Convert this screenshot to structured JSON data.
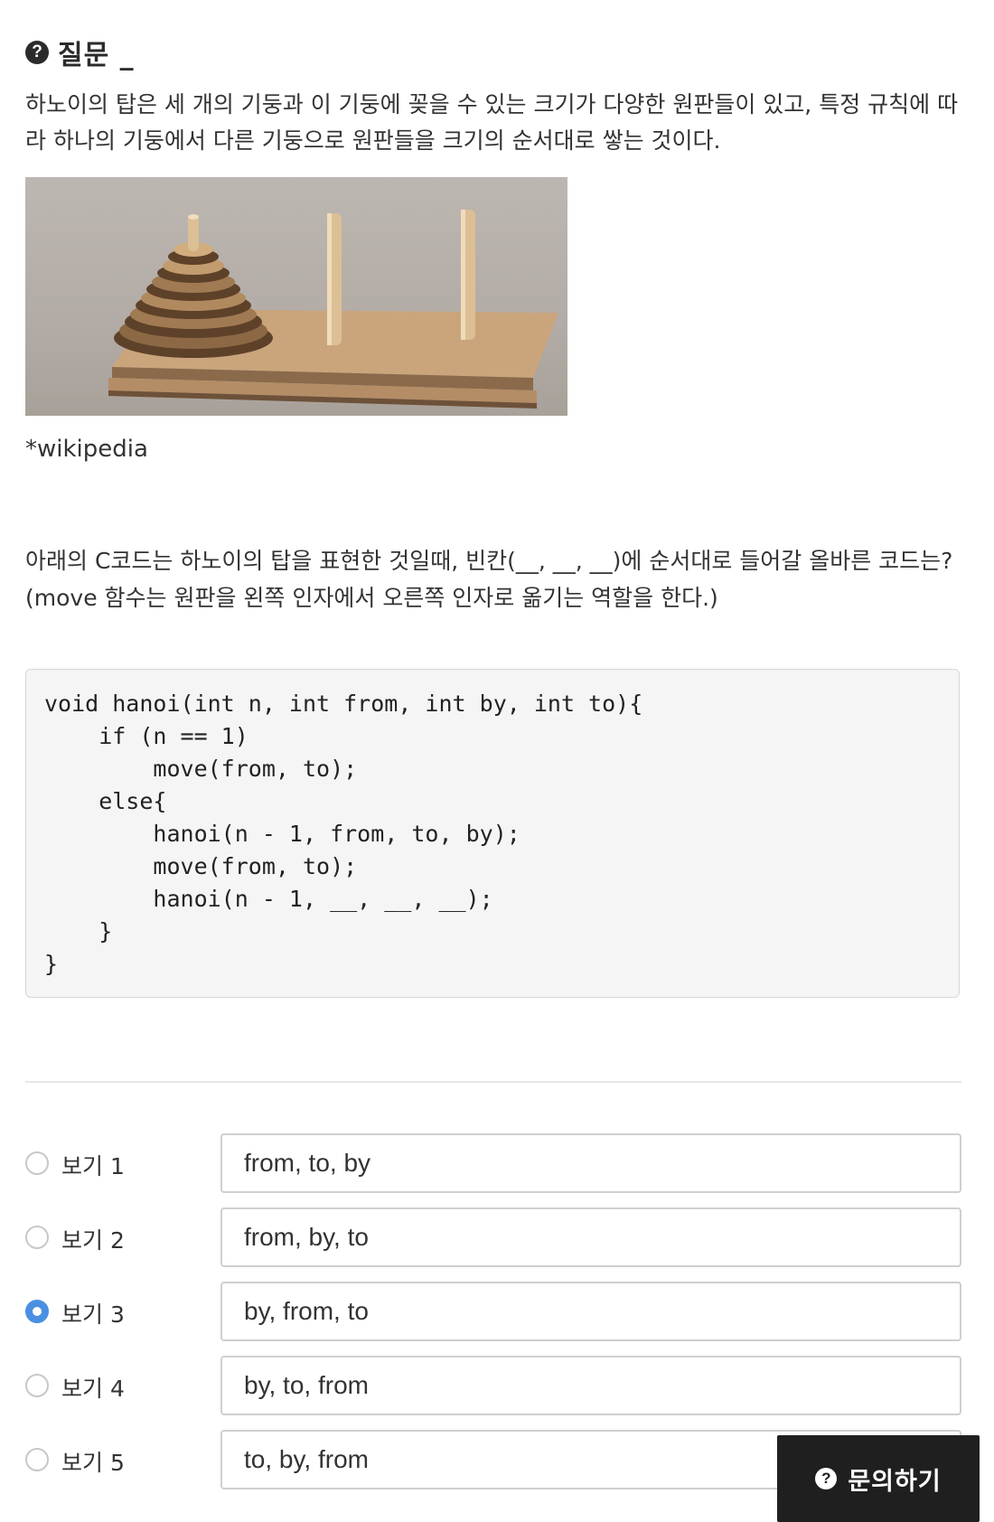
{
  "question": {
    "header_title": "질문 _",
    "description": "하노이의 탑은 세 개의 기둥과 이 기둥에 꽂을 수 있는 크기가 다양한 원판들이 있고, 특정 규칙에 따라 하나의 기둥에서 다른 기둥으로 원판들을 크기의 순서대로 쌓는 것이다.",
    "image_caption": "*wikipedia",
    "prompt": "아래의 C코드는 하노이의 탑을 표현한 것일때, 빈칸(__, __, __)에 순서대로 들어갈 올바른 코드는? (move 함수는 원판을 왼쪽 인자에서 오른쪽 인자로 옮기는 역할을 한다.)",
    "code": "void hanoi(int n, int from, int by, int to){\n    if (n == 1)\n        move(from, to);\n    else{\n        hanoi(n - 1, from, to, by);\n        move(from, to);\n        hanoi(n - 1, __, __, __);\n    }\n}"
  },
  "options": [
    {
      "label": "보기 1",
      "value": "from, to, by",
      "selected": false
    },
    {
      "label": "보기 2",
      "value": "from, by, to",
      "selected": false
    },
    {
      "label": "보기 3",
      "value": "by, from, to",
      "selected": true
    },
    {
      "label": "보기 4",
      "value": "by, to, from",
      "selected": false
    },
    {
      "label": "보기 5",
      "value": "to, by, from",
      "selected": false
    }
  ],
  "inquiry_button": {
    "label": "문의하기"
  },
  "colors": {
    "accent": "#4a90e2",
    "dark": "#1f1f1f"
  }
}
